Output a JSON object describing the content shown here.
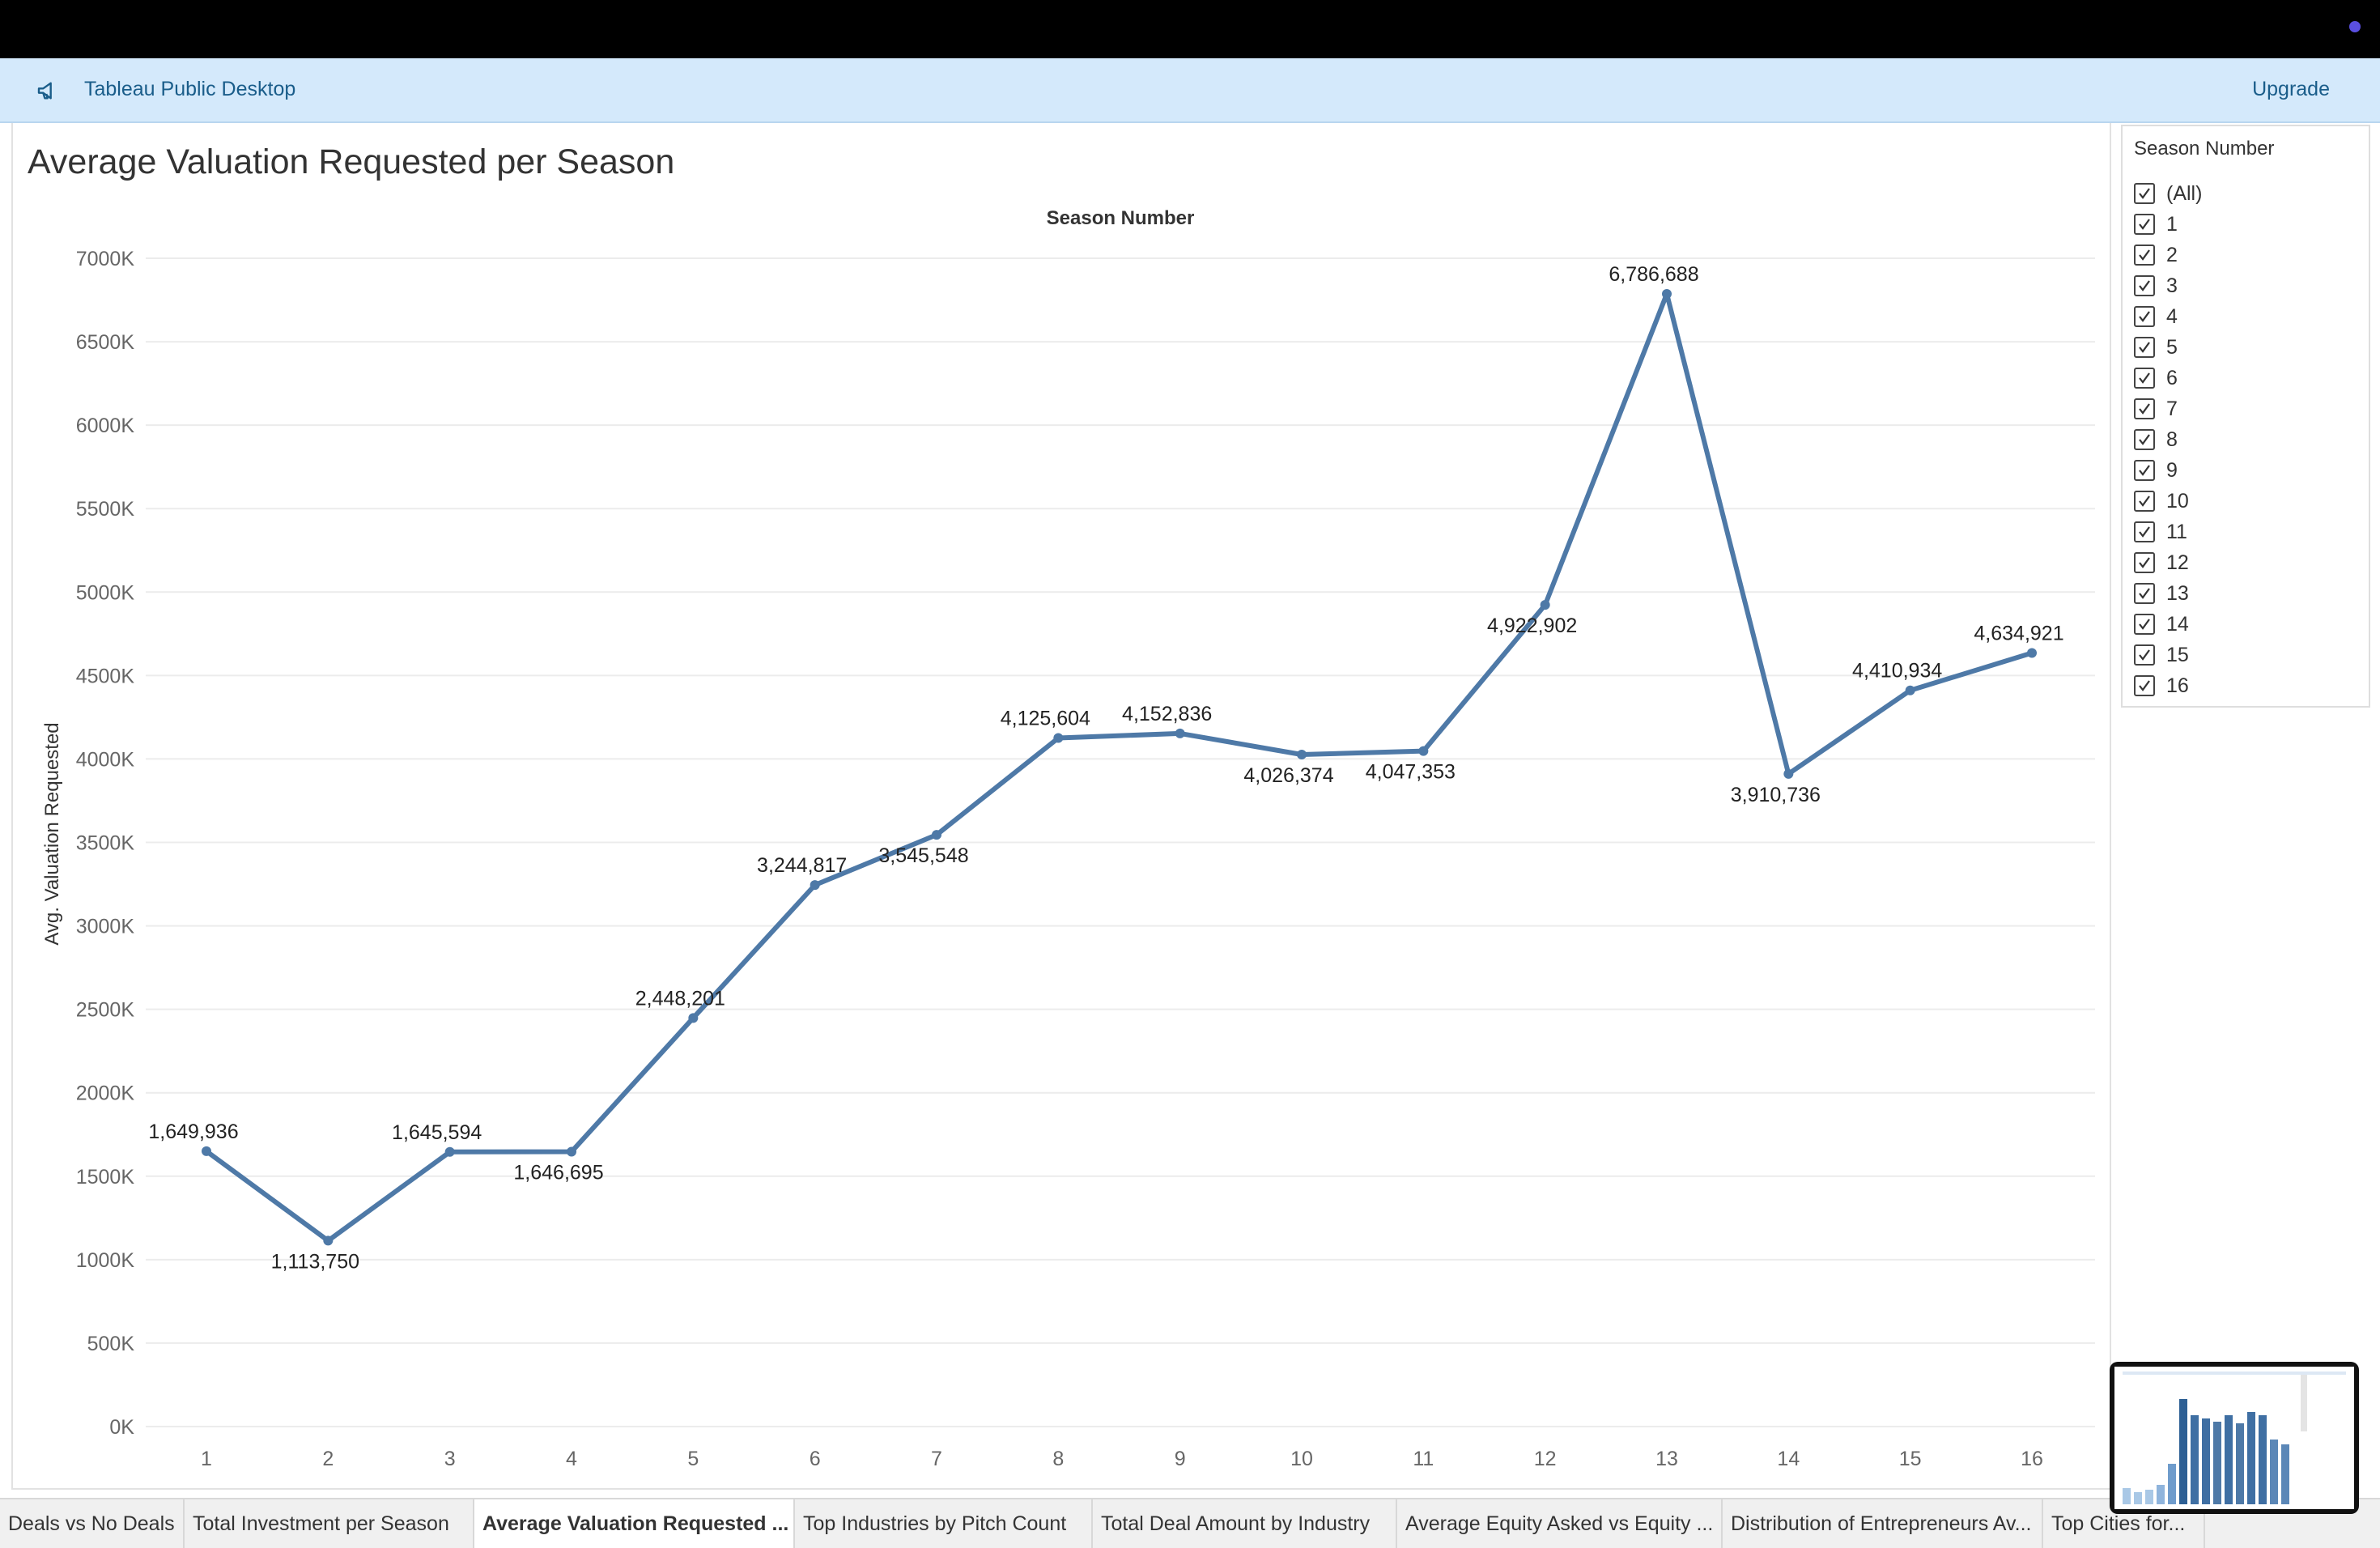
{
  "app": {
    "name": "Tableau Public Desktop",
    "upgrade_label": "Upgrade"
  },
  "sheet": {
    "title": "Average Valuation Requested per Season"
  },
  "chart_data": {
    "type": "line",
    "title": "Average Valuation Requested per Season",
    "xlabel": "Season Number",
    "ylabel": "Avg. Valuation Requested",
    "x": [
      1,
      2,
      3,
      4,
      5,
      6,
      7,
      8,
      9,
      10,
      11,
      12,
      13,
      14,
      15,
      16
    ],
    "values": [
      1649936,
      1113750,
      1645594,
      1646695,
      2448201,
      3244817,
      3545548,
      4125604,
      4152836,
      4026374,
      4047353,
      4922902,
      6786688,
      3910736,
      4410934,
      4634921
    ],
    "data_labels": [
      "1,649,936",
      "1,113,750",
      "1,645,594",
      "1,646,695",
      "2,448,201",
      "3,244,817",
      "3,545,548",
      "4,125,604",
      "4,152,836",
      "4,026,374",
      "4,047,353",
      "4,922,902",
      "6,786,688",
      "3,910,736",
      "4,410,934",
      "4,634,921"
    ],
    "label_position": [
      "above",
      "below",
      "above",
      "below",
      "above",
      "above",
      "below",
      "above",
      "above",
      "below",
      "below",
      "below",
      "above",
      "below",
      "above",
      "above"
    ],
    "y_ticks": [
      0,
      500000,
      1000000,
      1500000,
      2000000,
      2500000,
      3000000,
      3500000,
      4000000,
      4500000,
      5000000,
      5500000,
      6000000,
      6500000,
      7000000
    ],
    "y_tick_labels": [
      "0K",
      "500K",
      "1000K",
      "1500K",
      "2000K",
      "2500K",
      "3000K",
      "3500K",
      "4000K",
      "4500K",
      "5000K",
      "5500K",
      "6000K",
      "6500K",
      "7000K"
    ],
    "ylim": [
      0,
      7000000
    ],
    "grid": true,
    "line_color": "#4e79a7"
  },
  "filter": {
    "title": "Season Number",
    "items": [
      "(All)",
      "1",
      "2",
      "3",
      "4",
      "5",
      "6",
      "7",
      "8",
      "9",
      "10",
      "11",
      "12",
      "13",
      "14",
      "15",
      "16"
    ]
  },
  "tabs": [
    "Deals vs No Deals",
    "Total Investment per Season",
    "Average Valuation Requested ...",
    "Top Industries by Pitch Count",
    "Total Deal Amount by Industry",
    "Average Equity Asked vs Equity ...",
    "Distribution of Entrepreneurs Av...",
    "Top Cities for..."
  ],
  "active_tab_index": 2
}
